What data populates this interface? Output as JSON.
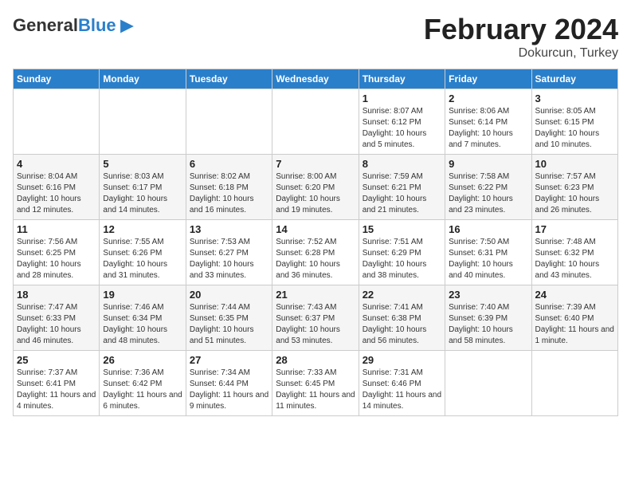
{
  "header": {
    "logo_general": "General",
    "logo_blue": "Blue",
    "month_title": "February 2024",
    "location": "Dokurcun, Turkey"
  },
  "days_of_week": [
    "Sunday",
    "Monday",
    "Tuesday",
    "Wednesday",
    "Thursday",
    "Friday",
    "Saturday"
  ],
  "weeks": [
    [
      {
        "day": "",
        "sunrise": "",
        "sunset": "",
        "daylight": ""
      },
      {
        "day": "",
        "sunrise": "",
        "sunset": "",
        "daylight": ""
      },
      {
        "day": "",
        "sunrise": "",
        "sunset": "",
        "daylight": ""
      },
      {
        "day": "",
        "sunrise": "",
        "sunset": "",
        "daylight": ""
      },
      {
        "day": "1",
        "sunrise": "Sunrise: 8:07 AM",
        "sunset": "Sunset: 6:12 PM",
        "daylight": "Daylight: 10 hours and 5 minutes."
      },
      {
        "day": "2",
        "sunrise": "Sunrise: 8:06 AM",
        "sunset": "Sunset: 6:14 PM",
        "daylight": "Daylight: 10 hours and 7 minutes."
      },
      {
        "day": "3",
        "sunrise": "Sunrise: 8:05 AM",
        "sunset": "Sunset: 6:15 PM",
        "daylight": "Daylight: 10 hours and 10 minutes."
      }
    ],
    [
      {
        "day": "4",
        "sunrise": "Sunrise: 8:04 AM",
        "sunset": "Sunset: 6:16 PM",
        "daylight": "Daylight: 10 hours and 12 minutes."
      },
      {
        "day": "5",
        "sunrise": "Sunrise: 8:03 AM",
        "sunset": "Sunset: 6:17 PM",
        "daylight": "Daylight: 10 hours and 14 minutes."
      },
      {
        "day": "6",
        "sunrise": "Sunrise: 8:02 AM",
        "sunset": "Sunset: 6:18 PM",
        "daylight": "Daylight: 10 hours and 16 minutes."
      },
      {
        "day": "7",
        "sunrise": "Sunrise: 8:00 AM",
        "sunset": "Sunset: 6:20 PM",
        "daylight": "Daylight: 10 hours and 19 minutes."
      },
      {
        "day": "8",
        "sunrise": "Sunrise: 7:59 AM",
        "sunset": "Sunset: 6:21 PM",
        "daylight": "Daylight: 10 hours and 21 minutes."
      },
      {
        "day": "9",
        "sunrise": "Sunrise: 7:58 AM",
        "sunset": "Sunset: 6:22 PM",
        "daylight": "Daylight: 10 hours and 23 minutes."
      },
      {
        "day": "10",
        "sunrise": "Sunrise: 7:57 AM",
        "sunset": "Sunset: 6:23 PM",
        "daylight": "Daylight: 10 hours and 26 minutes."
      }
    ],
    [
      {
        "day": "11",
        "sunrise": "Sunrise: 7:56 AM",
        "sunset": "Sunset: 6:25 PM",
        "daylight": "Daylight: 10 hours and 28 minutes."
      },
      {
        "day": "12",
        "sunrise": "Sunrise: 7:55 AM",
        "sunset": "Sunset: 6:26 PM",
        "daylight": "Daylight: 10 hours and 31 minutes."
      },
      {
        "day": "13",
        "sunrise": "Sunrise: 7:53 AM",
        "sunset": "Sunset: 6:27 PM",
        "daylight": "Daylight: 10 hours and 33 minutes."
      },
      {
        "day": "14",
        "sunrise": "Sunrise: 7:52 AM",
        "sunset": "Sunset: 6:28 PM",
        "daylight": "Daylight: 10 hours and 36 minutes."
      },
      {
        "day": "15",
        "sunrise": "Sunrise: 7:51 AM",
        "sunset": "Sunset: 6:29 PM",
        "daylight": "Daylight: 10 hours and 38 minutes."
      },
      {
        "day": "16",
        "sunrise": "Sunrise: 7:50 AM",
        "sunset": "Sunset: 6:31 PM",
        "daylight": "Daylight: 10 hours and 40 minutes."
      },
      {
        "day": "17",
        "sunrise": "Sunrise: 7:48 AM",
        "sunset": "Sunset: 6:32 PM",
        "daylight": "Daylight: 10 hours and 43 minutes."
      }
    ],
    [
      {
        "day": "18",
        "sunrise": "Sunrise: 7:47 AM",
        "sunset": "Sunset: 6:33 PM",
        "daylight": "Daylight: 10 hours and 46 minutes."
      },
      {
        "day": "19",
        "sunrise": "Sunrise: 7:46 AM",
        "sunset": "Sunset: 6:34 PM",
        "daylight": "Daylight: 10 hours and 48 minutes."
      },
      {
        "day": "20",
        "sunrise": "Sunrise: 7:44 AM",
        "sunset": "Sunset: 6:35 PM",
        "daylight": "Daylight: 10 hours and 51 minutes."
      },
      {
        "day": "21",
        "sunrise": "Sunrise: 7:43 AM",
        "sunset": "Sunset: 6:37 PM",
        "daylight": "Daylight: 10 hours and 53 minutes."
      },
      {
        "day": "22",
        "sunrise": "Sunrise: 7:41 AM",
        "sunset": "Sunset: 6:38 PM",
        "daylight": "Daylight: 10 hours and 56 minutes."
      },
      {
        "day": "23",
        "sunrise": "Sunrise: 7:40 AM",
        "sunset": "Sunset: 6:39 PM",
        "daylight": "Daylight: 10 hours and 58 minutes."
      },
      {
        "day": "24",
        "sunrise": "Sunrise: 7:39 AM",
        "sunset": "Sunset: 6:40 PM",
        "daylight": "Daylight: 11 hours and 1 minute."
      }
    ],
    [
      {
        "day": "25",
        "sunrise": "Sunrise: 7:37 AM",
        "sunset": "Sunset: 6:41 PM",
        "daylight": "Daylight: 11 hours and 4 minutes."
      },
      {
        "day": "26",
        "sunrise": "Sunrise: 7:36 AM",
        "sunset": "Sunset: 6:42 PM",
        "daylight": "Daylight: 11 hours and 6 minutes."
      },
      {
        "day": "27",
        "sunrise": "Sunrise: 7:34 AM",
        "sunset": "Sunset: 6:44 PM",
        "daylight": "Daylight: 11 hours and 9 minutes."
      },
      {
        "day": "28",
        "sunrise": "Sunrise: 7:33 AM",
        "sunset": "Sunset: 6:45 PM",
        "daylight": "Daylight: 11 hours and 11 minutes."
      },
      {
        "day": "29",
        "sunrise": "Sunrise: 7:31 AM",
        "sunset": "Sunset: 6:46 PM",
        "daylight": "Daylight: 11 hours and 14 minutes."
      },
      {
        "day": "",
        "sunrise": "",
        "sunset": "",
        "daylight": ""
      },
      {
        "day": "",
        "sunrise": "",
        "sunset": "",
        "daylight": ""
      }
    ]
  ]
}
